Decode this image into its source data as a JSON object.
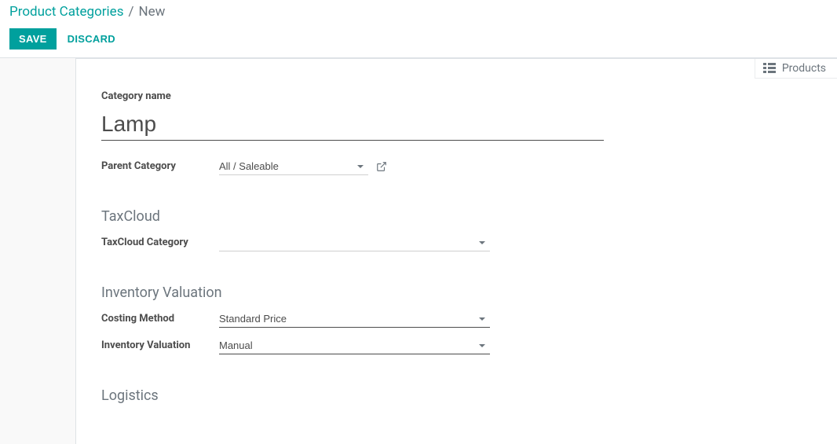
{
  "breadcrumb": {
    "parent": "Product Categories",
    "separator": "/",
    "current": "New"
  },
  "actions": {
    "save": "SAVE",
    "discard": "DISCARD"
  },
  "stat_button": {
    "label": "Products"
  },
  "fields": {
    "category_name_label": "Category name",
    "category_name_value": "Lamp",
    "parent_category_label": "Parent Category",
    "parent_category_value": "All / Saleable",
    "taxcloud_category_label": "TaxCloud Category",
    "taxcloud_category_value": "",
    "costing_method_label": "Costing Method",
    "costing_method_value": "Standard Price",
    "inventory_valuation_label": "Inventory Valuation",
    "inventory_valuation_value": "Manual"
  },
  "sections": {
    "taxcloud": "TaxCloud",
    "inventory_valuation": "Inventory Valuation",
    "logistics": "Logistics"
  }
}
